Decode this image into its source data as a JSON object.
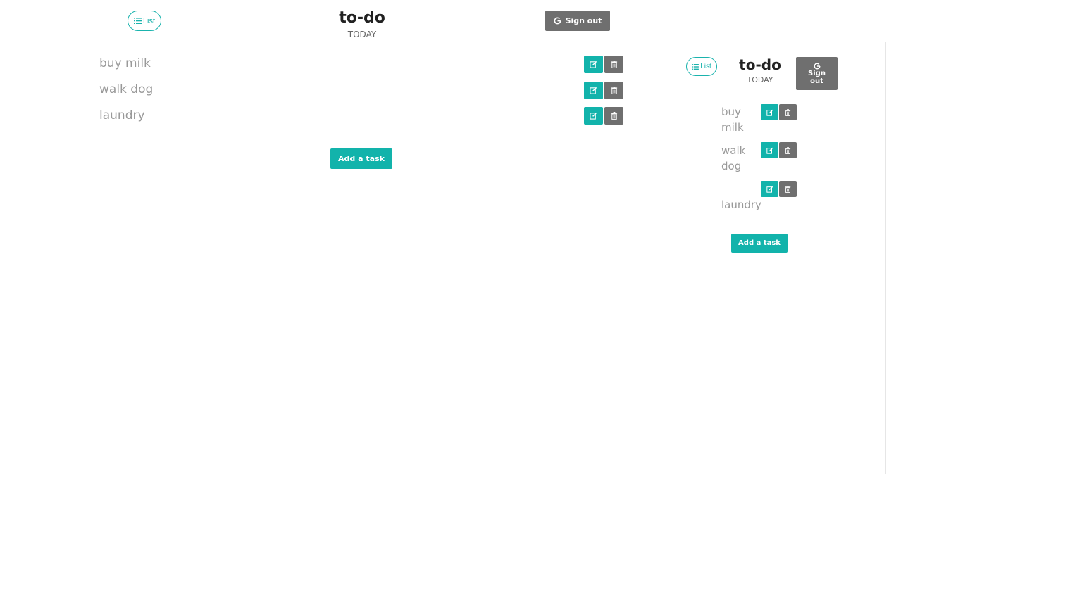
{
  "header": {
    "list_label": "List",
    "title": "to-do",
    "subtitle": "TODAY",
    "signout_label": "Sign out",
    "signout_line1": "Sign",
    "signout_line2": "out"
  },
  "tasks": [
    {
      "label": "buy milk",
      "line1": "buy",
      "line2": "milk"
    },
    {
      "label": "walk dog",
      "line1": "walk",
      "line2": "dog"
    },
    {
      "label": "laundry",
      "line1": "laundry",
      "line2": ""
    }
  ],
  "add_task_label": "Add a task",
  "icons": {
    "list": "list-icon",
    "signout": "google-icon",
    "edit": "edit-icon",
    "delete": "trash-icon"
  },
  "colors": {
    "accent": "#12b3ab",
    "secondary": "#6f6f6f",
    "task_text": "#999999"
  }
}
